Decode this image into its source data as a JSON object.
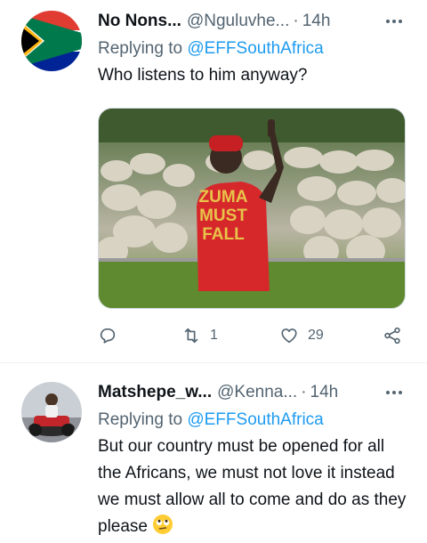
{
  "tweets": [
    {
      "author_name": "No Nons...",
      "author_handle": "@Nguluvhe...",
      "separator": "·",
      "time": "14h",
      "reply_prefix": "Replying to ",
      "reply_to": "@EFFSouthAfrica",
      "text": "Who listens to him anyway?",
      "media": {
        "shirt_text": [
          "ZUMA",
          "MUST",
          "FALL"
        ]
      },
      "retweets": "1",
      "likes": "29",
      "avatar_icon": "south-africa-flag"
    },
    {
      "author_name": "Matshepe_w...",
      "author_handle": "@Kenna...",
      "separator": "·",
      "time": "14h",
      "reply_prefix": "Replying to ",
      "reply_to": "@EFFSouthAfrica",
      "text": "But our country must be opened for all the Africans, we must not love it instead we must allow all to come and do as they please",
      "emoji_icon": "rolling-eyes-emoji"
    }
  ],
  "colors": {
    "accent": "#1d9bf0",
    "muted": "#536471",
    "text": "#0f1419",
    "shirt_red": "#d6282b",
    "shirt_text": "#e8c24a"
  }
}
